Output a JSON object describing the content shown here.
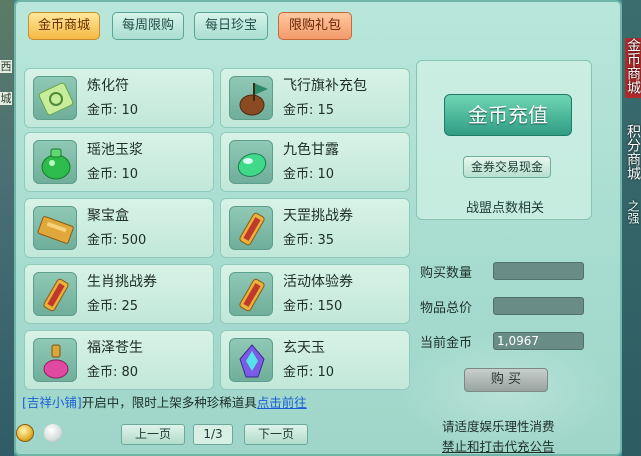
{
  "tabs": [
    {
      "label": "金币商城",
      "active": true
    },
    {
      "label": "每周限购",
      "active": false
    },
    {
      "label": "每日珍宝",
      "active": false
    },
    {
      "label": "限购礼包",
      "active": false
    }
  ],
  "items": [
    {
      "name": "炼化符",
      "price": "金币: 10",
      "icon": "talisman-icon"
    },
    {
      "name": "飞行旗补充包",
      "price": "金币: 15",
      "icon": "flag-pack-icon"
    },
    {
      "name": "瑶池玉浆",
      "price": "金币: 10",
      "icon": "jade-jar-icon"
    },
    {
      "name": "九色甘露",
      "price": "金币: 10",
      "icon": "dew-gem-icon"
    },
    {
      "name": "聚宝盒",
      "price": "金币: 500",
      "icon": "treasure-box-icon"
    },
    {
      "name": "天罡挑战券",
      "price": "金币: 35",
      "icon": "scroll-icon"
    },
    {
      "name": "生肖挑战券",
      "price": "金币: 25",
      "icon": "scroll-icon"
    },
    {
      "name": "活动体验券",
      "price": "金币: 150",
      "icon": "scroll-icon"
    },
    {
      "name": "福泽苍生",
      "price": "金币: 80",
      "icon": "potion-icon"
    },
    {
      "name": "玄天玉",
      "price": "金币: 10",
      "icon": "crystal-icon"
    }
  ],
  "right_pane": {
    "topup_label": "金币充值",
    "exchange_label": "金券交易现金",
    "league_label": "战盟点数相关",
    "qty_label": "购买数量",
    "qty_value": "",
    "total_label": "物品总价",
    "total_value": "",
    "balance_label": "当前金币",
    "balance_value": "1,0967",
    "buy_label": "购 买"
  },
  "notice": {
    "tag": "[吉祥小铺]",
    "text": "开启中，限时上架多种珍稀道具",
    "link": "点击前往"
  },
  "pager": {
    "prev": "上一页",
    "page": "1/3",
    "next": "下一页"
  },
  "footer": {
    "line1": "请适度娱乐理性消费",
    "line2": "禁止和打击代充公告"
  },
  "edge": {
    "left_tags": [
      "西",
      "城"
    ],
    "right_vtext_1": "金币商城",
    "right_vtext_2": "积分商城",
    "right_vtext_3": "之强"
  },
  "colors": {
    "panel_bg": "#b9e6da",
    "active_tab": "#f5b945",
    "promo_tab": "#f29a6a",
    "topup_button": "#2f9c83",
    "link_blue": "#1a5fd6"
  }
}
